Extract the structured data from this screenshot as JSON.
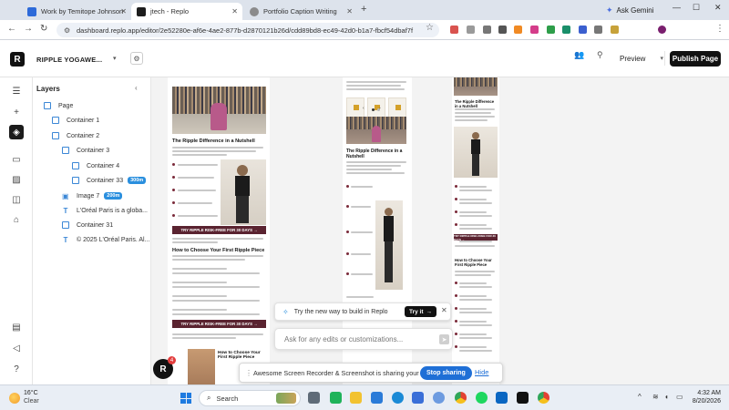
{
  "browser": {
    "tabs": [
      {
        "title": "Work by Temitope Johnson",
        "active": false
      },
      {
        "title": "jtech - Replo",
        "active": true
      },
      {
        "title": "Portfolio Caption Writing",
        "active": false
      }
    ],
    "new_tab": "+",
    "ask_gemini": "Ask Gemini",
    "url": "dashboard.replo.app/editor/2e52280e-af6e-4ae2-877b-d2870121b26d/cdd89bd8-ec49-42d0-b1a7-fbcf54dbaf7f",
    "window_controls": {
      "minimize": "—",
      "maximize": "☐",
      "close": "✕"
    }
  },
  "app": {
    "logo": "R",
    "project_name": "RIPPLE YOGAWE...",
    "preview_label": "Preview",
    "publish_label": "Publish Page"
  },
  "layers": {
    "title": "Layers",
    "items": [
      {
        "label": "Page",
        "kind": "page",
        "depth": 0
      },
      {
        "label": "Container 1",
        "kind": "container",
        "depth": 1
      },
      {
        "label": "Container 2",
        "kind": "container",
        "depth": 1
      },
      {
        "label": "Container 3",
        "kind": "container",
        "depth": 2
      },
      {
        "label": "Container 4",
        "kind": "container",
        "depth": 3
      },
      {
        "label": "Container 33",
        "kind": "container",
        "depth": 3,
        "badge": "300m"
      },
      {
        "label": "Image 7",
        "kind": "image",
        "depth": 2,
        "badge": "200m"
      },
      {
        "label": "L'Oréal Paris is a globa...",
        "kind": "text",
        "depth": 2
      },
      {
        "label": "Container 31",
        "kind": "container",
        "depth": 2
      },
      {
        "label": "© 2025 L'Oréal Paris. Al...",
        "kind": "text",
        "depth": 2
      }
    ]
  },
  "canvas": {
    "left_frame": {
      "heading1": "The Ripple Difference in a Nutshell",
      "cta1": "TRY RIPPLE RISK-FREE FOR 30 DAYS →",
      "heading2": "How to Choose Your First Ripple Piece",
      "cta2": "TRY RIPPLE RISK-FREE FOR 30 DAYS →",
      "bottom_heading": "How to Choose Your First Ripple Piece"
    },
    "middle_frame": {
      "heading": "The Ripple Difference in a Nutshell"
    },
    "right_frame": {
      "heading1": "The Ripple Difference in a Nutshell",
      "heading2": "How to Choose Your First Ripple Piece",
      "cta": "TRY RIPPLE RISK-FREE FOR 30 DAYS →"
    }
  },
  "overlays": {
    "try_prompt": "Try the new way to build in Replo",
    "try_button": "Try it",
    "ask_placeholder": "Ask for any edits or customizations...",
    "help_count": "4",
    "share_message": "Awesome Screen Recorder & Screenshot is sharing your screen.",
    "stop_sharing": "Stop sharing",
    "hide": "Hide"
  },
  "taskbar": {
    "weather_temp": "16°C",
    "weather_cond": "Clear",
    "search_placeholder": "Search",
    "time": "4:32 AM",
    "date": "8/20/2026"
  },
  "colors": {
    "accent_blue": "#2a8fde",
    "cta_maroon": "#5a2330",
    "publish_black": "#111111"
  }
}
